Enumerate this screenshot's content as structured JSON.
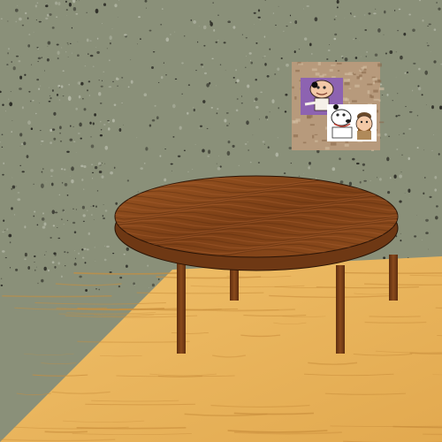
{
  "scene": {
    "description_type": "3d-room-render",
    "colors": {
      "wall": "#8a9079",
      "wall_speckle_dark": "#2c2c26",
      "wall_speckle_light": "#b3b7a6",
      "floor": "#e8b25a",
      "floor_grain": "#c98e3c",
      "table_top": "#8a4a1c",
      "table_top_dark": "#5e2e0f",
      "table_edge": "#6e3814",
      "table_leg": "#7a3e14",
      "frame_bg": "#b79a7c",
      "poster_purple": "#8d63b1",
      "poster_white": "#ffffff"
    }
  },
  "items": [
    {
      "name": "wall",
      "interactable": false
    },
    {
      "name": "floor",
      "interactable": false
    },
    {
      "name": "table",
      "interactable": true
    },
    {
      "name": "wall-poster",
      "interactable": true
    }
  ]
}
